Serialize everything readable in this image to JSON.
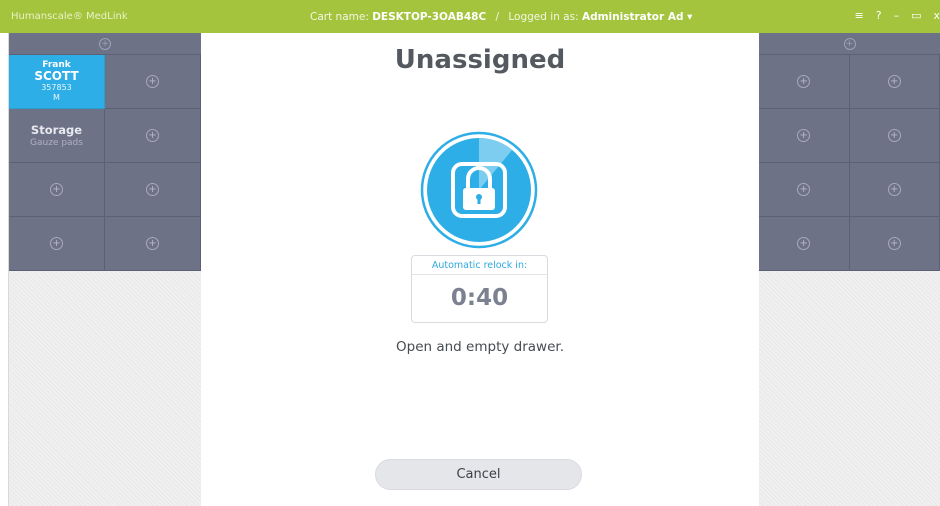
{
  "titlebar": {
    "app_name": "Humanscale® MedLink",
    "cart_label": "Cart name:",
    "cart_name": "DESKTOP-3OAB48C",
    "separator": "/",
    "login_label": "Logged in as:",
    "user": "Administrator Ad",
    "user_caret": "▾",
    "menu_glyph": "≡",
    "help_glyph": "?",
    "minimize_glyph": "–",
    "maximize_glyph": "▭",
    "close_glyph": "x"
  },
  "left_panel": {
    "patient": {
      "first_name": "Frank",
      "last_name": "SCOTT",
      "id": "357853",
      "sex": "M"
    },
    "storage": {
      "title": "Storage",
      "subtitle": "Gauze pads"
    },
    "add_glyph": "+",
    "head_glyph": "+"
  },
  "main": {
    "title": "Unassigned",
    "relock_label": "Automatic relock in:",
    "relock_time": "0:40",
    "instruction": "Open and empty drawer.",
    "cancel_label": "Cancel",
    "relock_progress": 0.11
  },
  "colors": {
    "title_bar": "#a3c43c",
    "drawer": "#6d7287",
    "patient": "#2eaee6",
    "lock_blue": "#2eaee6"
  }
}
